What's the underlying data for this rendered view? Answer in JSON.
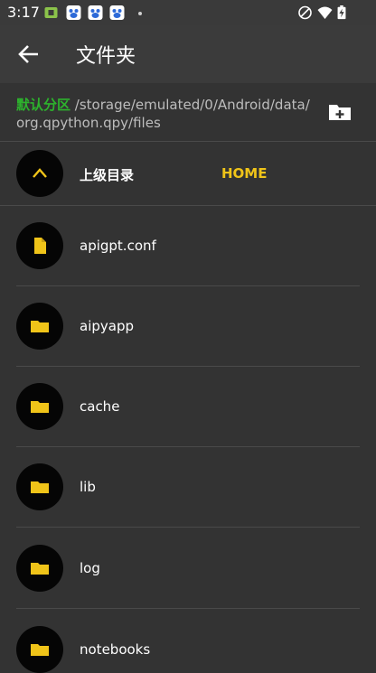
{
  "status_bar": {
    "time": "3:17"
  },
  "app_bar": {
    "title": "文件夹"
  },
  "path_bar": {
    "drive_label": "默认分区",
    "path": "/storage/emulated/0/Android/data/org.qpython.qpy/files"
  },
  "nav": {
    "up_label": "上级目录",
    "home_label": "HOME"
  },
  "items": [
    {
      "name": "apigpt.conf",
      "type": "file"
    },
    {
      "name": "aipyapp",
      "type": "folder"
    },
    {
      "name": "cache",
      "type": "folder"
    },
    {
      "name": "lib",
      "type": "folder"
    },
    {
      "name": "log",
      "type": "folder"
    },
    {
      "name": "notebooks",
      "type": "folder"
    }
  ],
  "colors": {
    "accent": "#f0c419",
    "drive": "#2db32d",
    "background": "#333333"
  }
}
